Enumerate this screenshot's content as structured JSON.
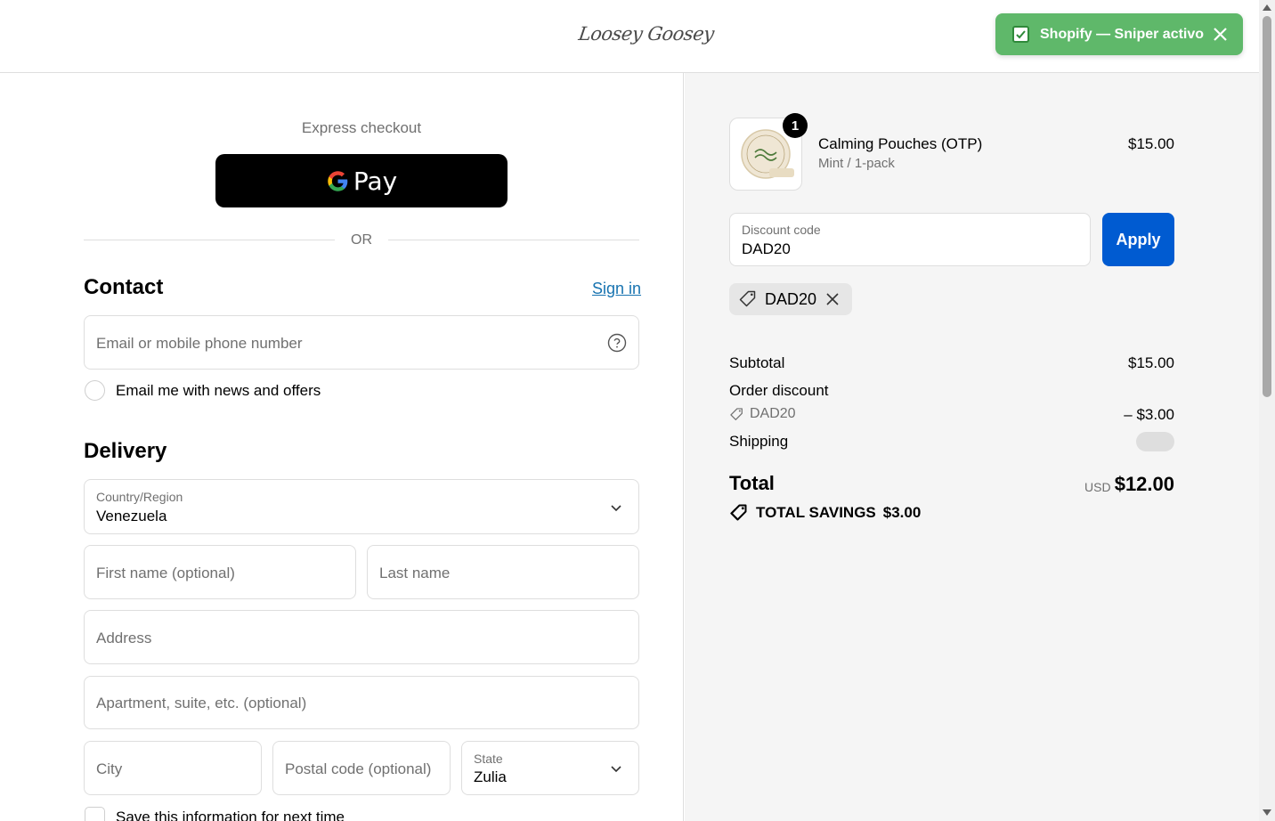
{
  "header": {
    "logo_text": "Loosey Goosey",
    "cart_icon": "shopping-bag-icon"
  },
  "toast": {
    "text": "Shopify — Sniper activo",
    "icon": "checkbox-checked-icon",
    "close_icon": "close-icon"
  },
  "express": {
    "label": "Express checkout",
    "gpay_label": "Pay",
    "or_label": "OR"
  },
  "contact": {
    "title": "Contact",
    "sign_in": "Sign in",
    "email_placeholder": "Email or mobile phone number",
    "news_label": "Email me with news and offers"
  },
  "delivery": {
    "title": "Delivery",
    "country_label": "Country/Region",
    "country_value": "Venezuela",
    "first_name_placeholder": "First name (optional)",
    "last_name_placeholder": "Last name",
    "address_placeholder": "Address",
    "apartment_placeholder": "Apartment, suite, etc. (optional)",
    "city_placeholder": "City",
    "postal_placeholder": "Postal code (optional)",
    "state_label": "State",
    "state_value": "Zulia",
    "save_info_label": "Save this information for next time"
  },
  "order": {
    "product": {
      "name": "Calming Pouches (OTP)",
      "variant": "Mint / 1-pack",
      "price": "$15.00",
      "quantity": "1"
    },
    "discount": {
      "label": "Discount code",
      "value": "DAD20",
      "apply_label": "Apply",
      "applied_code": "DAD20"
    },
    "summary": {
      "subtotal_label": "Subtotal",
      "subtotal_value": "$15.00",
      "order_discount_label": "Order discount",
      "discount_code": "DAD20",
      "discount_amount": "– $3.00",
      "shipping_label": "Shipping",
      "total_label": "Total",
      "currency": "USD",
      "total_value": "$12.00",
      "savings_label": "TOTAL SAVINGS",
      "savings_value": "$3.00"
    }
  },
  "colors": {
    "accent": "#005bd1",
    "link": "#1773b0",
    "toast": "#5fb86a",
    "summary_bg": "#f5f5f5"
  }
}
